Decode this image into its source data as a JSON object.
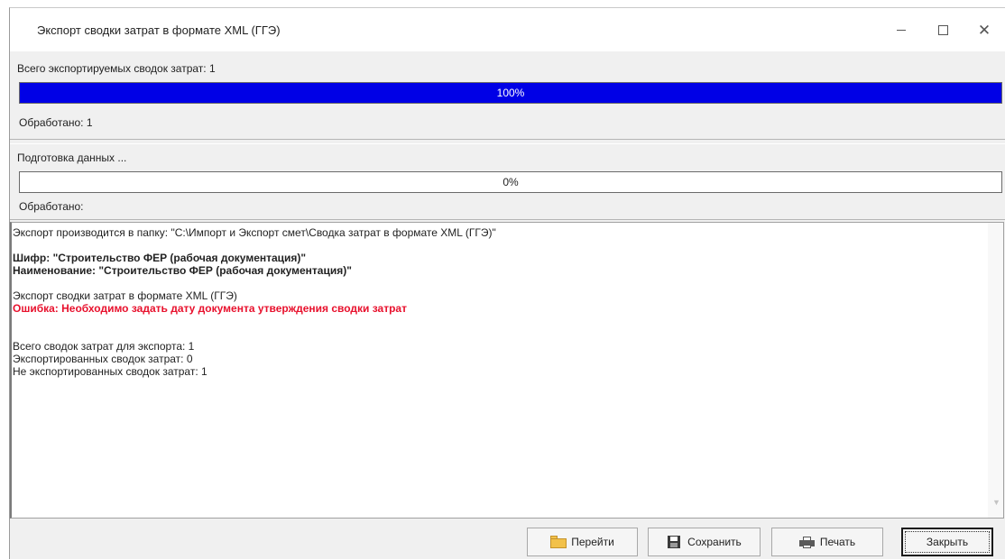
{
  "window": {
    "title": "Экспорт сводки затрат в формате XML (ГГЭ)",
    "controls": {
      "minimize": "minimize-icon",
      "maximize": "maximize-icon",
      "close": "close-icon"
    }
  },
  "overall": {
    "label": "Всего экспортируемых сводок затрат: 1",
    "progress_percent": 100,
    "progress_text": "100%",
    "processed_label": "Обработано: 1"
  },
  "current": {
    "label": "Подготовка данных ...",
    "progress_percent": 0,
    "progress_text": "0%",
    "processed_label": "Обработано:"
  },
  "log": {
    "export_path": "Экспорт производится в папку: \"C:\\Импорт и Экспорт смет\\Сводка затрат в формате XML (ГГЭ)\"",
    "cipher": "Шифр: \"Строительство ФЕР (рабочая документация)\"",
    "name": "Наименование: \"Строительство ФЕР (рабочая документация)\"",
    "operation": "Экспорт сводки затрат в формате XML (ГГЭ)",
    "error": "Ошибка: Необходимо задать дату документа утверждения сводки затрат",
    "total": "Всего сводок затрат для экспорта: 1",
    "exported": "Экспортированных сводок затрат: 0",
    "not_exported": "Не экспортированных сводок затрат: 1"
  },
  "buttons": {
    "goto": "Перейти",
    "save": "Сохранить",
    "print": "Печать",
    "close": "Закрыть"
  },
  "colors": {
    "progress_fill": "#0000e6",
    "error_text": "#e8112d"
  }
}
